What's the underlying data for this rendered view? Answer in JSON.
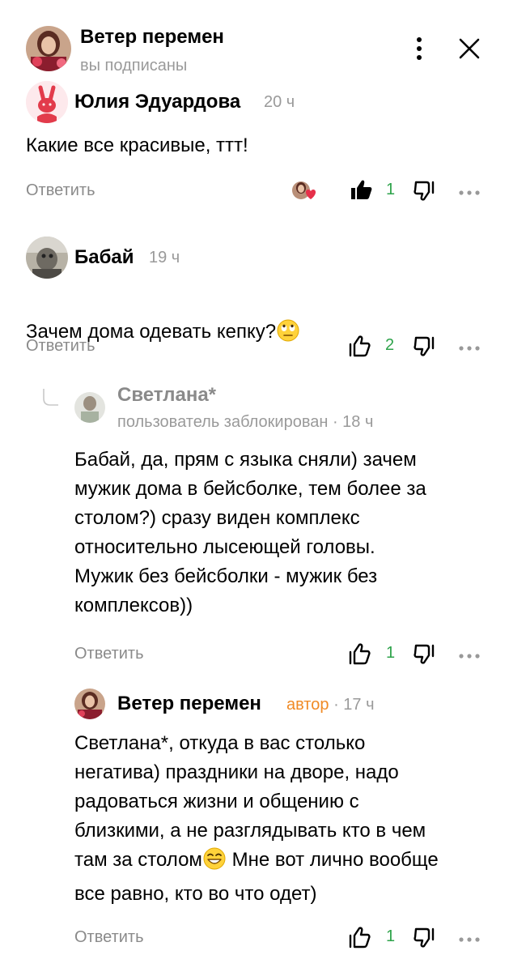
{
  "header": {
    "channel_name": "Ветер перемен",
    "subscription_status": "вы подписаны",
    "menu_icon": "vertical-dots-icon",
    "close_icon": "close-icon"
  },
  "comments": [
    {
      "author": "Юлия Эдуардова",
      "time": "20 ч",
      "text": "Какие все красивые, ттт!",
      "reply_label": "Ответить",
      "likes": "1",
      "liked": true
    },
    {
      "author": "Бабай",
      "time": "19 ч",
      "text": "Зачем дома одевать кепку?",
      "emoji": "eye-roll-emoji",
      "reply_label": "Ответить",
      "likes": "2",
      "liked": false
    },
    {
      "author": "Светлана*",
      "meta": "пользователь заблокирован · 18 ч",
      "text": "Бабай, да, прям с языка сняли) зачем\nмужик дома в бейсболке, тем более за\nстолом?) сразу виден комплекс\nотносительно лысеющей головы.\nМужик без бейсболки - мужик без\nкомплексов))",
      "reply_label": "Ответить",
      "likes": "1",
      "liked": false
    },
    {
      "author": "Ветер перемен",
      "badge": "автор",
      "time": "· 17 ч",
      "text_lines": [
        "Светлана*, откуда в вас столько",
        "негатива) праздники на дворе, надо",
        "радоваться жизни и общению с",
        "близкими, а не разглядывать кто в чем"
      ],
      "text_line5_before": "там за столом",
      "text_line5_after": " Мне вот лично вообще",
      "text_line6": "все равно, кто во что одет)",
      "emoji": "grin-emoji",
      "reply_label": "Ответить",
      "likes": "1",
      "liked": false
    }
  ],
  "colors": {
    "like_count": "#2ea34b",
    "author_badge": "#f08a24",
    "muted_text": "#8a8a8a"
  }
}
